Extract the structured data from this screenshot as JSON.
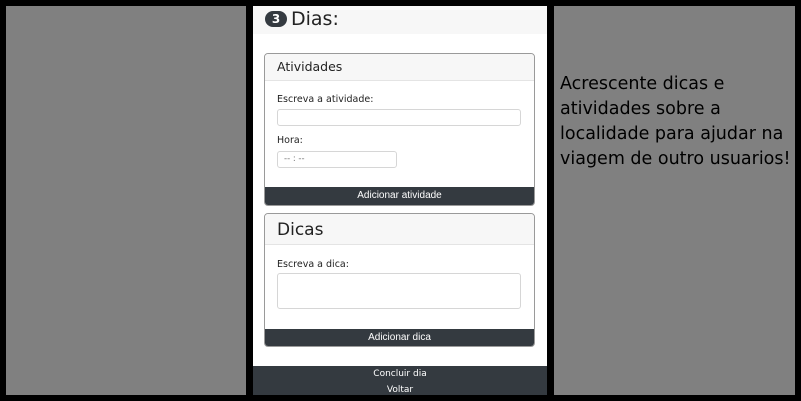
{
  "hint_text": "Acrescente dicas e atividades sobre a localidade para ajudar na viagem de outro usuarios!",
  "dias": {
    "badge": "3",
    "title": "Dias:"
  },
  "atividades": {
    "title": "Atividades",
    "activity_label": "Escreva a atividade:",
    "activity_value": "",
    "hour_label": "Hora:",
    "hour_placeholder": "-- : --",
    "add_button": "Adicionar atividade"
  },
  "dicas": {
    "title": "Dicas",
    "tip_label": "Escreva a dica:",
    "tip_value": "",
    "add_button": "Adicionar dica"
  },
  "footer": {
    "conclude_button": "Concluir dia",
    "back_button": "Voltar"
  },
  "colors": {
    "dark_button": "#343a40",
    "backdrop": "#808080",
    "card_header": "#f7f7f7"
  }
}
